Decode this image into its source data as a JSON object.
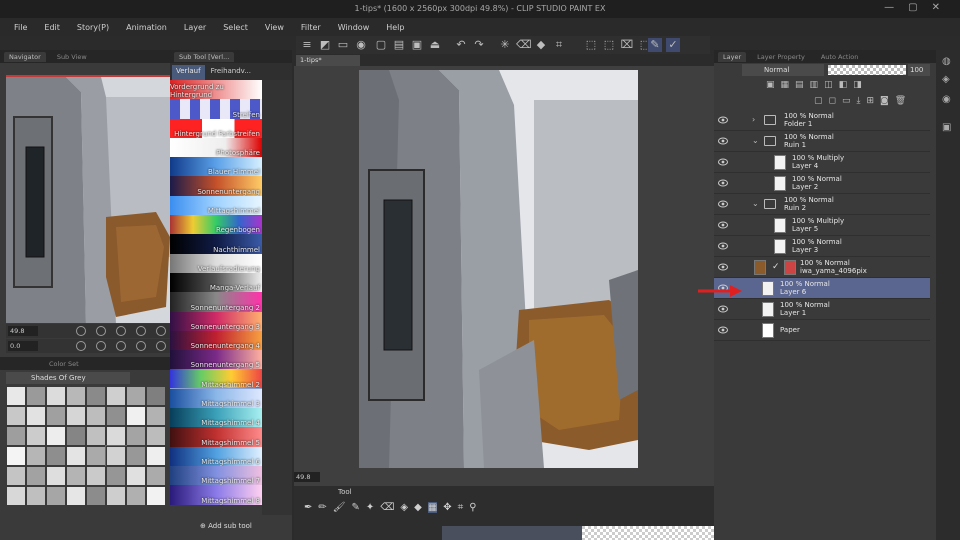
{
  "titlebar": {
    "title": "1-tips* (1600 x 2560px 300dpi 49.8%) - CLIP STUDIO PAINT EX"
  },
  "menu": [
    "File",
    "Edit",
    "Story(P)",
    "Animation",
    "Layer",
    "Select",
    "View",
    "Filter",
    "Window",
    "Help"
  ],
  "left_panel": {
    "tabs": [
      "Navigator",
      "Sub View"
    ],
    "zoom_value": "49.8",
    "angle_value": "0.0",
    "colorset_tab": "Color Set",
    "colorset_name": "Shades Of Grey",
    "swatches": [
      "#e8e8e8",
      "#9a9a9a",
      "#dcdcdc",
      "#b8b8b8",
      "#8a8a8a",
      "#cfcfcf",
      "#a8a8a8",
      "#7f7f7f",
      "#c8c8c8",
      "#e2e2e2",
      "#a0a0a0",
      "#d6d6d6",
      "#bdbdbd",
      "#909090",
      "#f0f0f0",
      "#b2b2b2",
      "#9e9e9e",
      "#cccccc",
      "#ededed",
      "#858585",
      "#c0c0c0",
      "#dadada",
      "#a4a4a4",
      "#bcbcbc",
      "#f4f4f4",
      "#b6b6b6",
      "#8e8e8e",
      "#e4e4e4",
      "#aaaaaa",
      "#d2d2d2",
      "#989898",
      "#eeeeee",
      "#c4c4c4",
      "#a2a2a2",
      "#dedede",
      "#b4b4b4",
      "#cacaca",
      "#969696",
      "#e0e0e0",
      "#ababab",
      "#d8d8d8",
      "#bfbfbf",
      "#a6a6a6",
      "#e6e6e6",
      "#8c8c8c",
      "#cecece",
      "#b0b0b0",
      "#f2f2f2"
    ]
  },
  "subtool_panel": {
    "header_tab": "Sub Tool [Verl...",
    "tabs": [
      "Verlauf",
      "Freihandv..."
    ],
    "add_label": "Add sub tool",
    "gradients": [
      {
        "label": "Vordergrund zu Hintergrund",
        "css": "linear-gradient(90deg,#d22,#fff)"
      },
      {
        "label": "Streifen",
        "css": "repeating-linear-gradient(90deg,#4d58c9 0 10px,#e8e8f8 10px 20px)"
      },
      {
        "label": "Hintergrund Farbstreifen",
        "css": "linear-gradient(90deg,#f22 0 35%,#fff 35% 70%,#f22 70%)"
      },
      {
        "label": "Photosphäre",
        "css": "linear-gradient(90deg,#fff,#eee 60%,#d00)"
      },
      {
        "label": "Blauer Himmel",
        "css": "linear-gradient(90deg,#103a8a,#5aa0e8,#d6f0ff)"
      },
      {
        "label": "Sonnenuntergang",
        "css": "linear-gradient(90deg,#1b1b4a,#c4502a,#ffcc66)"
      },
      {
        "label": "Mittagshimmel",
        "css": "linear-gradient(90deg,#3b8ef0,#9fd2ff,#e8f6ff)"
      },
      {
        "label": "Regenbogen",
        "css": "linear-gradient(90deg,#a33,#ec3,#3c6,#36c,#a3c)"
      },
      {
        "label": "Nachthimmel",
        "css": "linear-gradient(90deg,#000,#101b45,#3a5aa8)"
      },
      {
        "label": "Verlaufsradierung",
        "css": "linear-gradient(90deg,#777,#ddd,#fff)"
      },
      {
        "label": "Manga-Verlauf",
        "css": "linear-gradient(90deg,#000,#555,#eee)"
      },
      {
        "label": "Sonnenuntergang 2",
        "css": "linear-gradient(90deg,#222,#888,#f3a)"
      },
      {
        "label": "Sonnenuntergang 3",
        "css": "linear-gradient(90deg,#301045,#d02a66,#ffb070)"
      },
      {
        "label": "Sonnenuntergang 4",
        "css": "linear-gradient(90deg,#2a1140,#c02030,#f7a040)"
      },
      {
        "label": "Sonnenuntergang 5",
        "css": "linear-gradient(90deg,#20103a,#7a2a88,#ffb0a0)"
      },
      {
        "label": "Mittagshimmel 2",
        "css": "linear-gradient(90deg,#33d,#6c6,#fc3,#e44)"
      },
      {
        "label": "Mittagshimmel 3",
        "css": "linear-gradient(90deg,#1a4fa0,#8ab6e8,#dfe8ff)"
      },
      {
        "label": "Mittagshimmel 4",
        "css": "linear-gradient(90deg,#073e5a,#3aa0b8,#a8f0f0)"
      },
      {
        "label": "Mittagshimmel 5",
        "css": "linear-gradient(90deg,#401010,#c03030,#ff8a8a)"
      },
      {
        "label": "Mittagshimmel 6",
        "css": "linear-gradient(90deg,#103080,#50a0e0,#e0f0ff)"
      },
      {
        "label": "Mittagshimmel 7",
        "css": "linear-gradient(90deg,#204080,#8090e0,#f0c0e0)"
      },
      {
        "label": "Mittagshimmel 8",
        "css": "linear-gradient(90deg,#2a1a7a,#8a7ae8,#ffd0f0)"
      }
    ]
  },
  "canvas": {
    "doc_tab": "1-tips*",
    "zoom": "49.8"
  },
  "tool_panel": {
    "tab": "Tool"
  },
  "layer_panel": {
    "tabs": [
      "Layer",
      "Layer Property",
      "Auto Action"
    ],
    "blend_mode": "Normal",
    "opacity": "100",
    "layers": [
      {
        "line1": "100 % Normal",
        "line2": "Folder 1",
        "kind": "folder",
        "indent": 0,
        "chev": "›",
        "sel": false
      },
      {
        "line1": "100 % Normal",
        "line2": "Ruin 1",
        "kind": "folder",
        "indent": 0,
        "chev": "⌄",
        "sel": false
      },
      {
        "line1": "100 % Multiply",
        "line2": "Layer 4",
        "kind": "layer",
        "indent": 1,
        "chev": "",
        "sel": false
      },
      {
        "line1": "100 % Normal",
        "line2": "Layer 2",
        "kind": "layer",
        "indent": 1,
        "chev": "",
        "sel": false
      },
      {
        "line1": "100 % Normal",
        "line2": "Ruin 2",
        "kind": "folder",
        "indent": 0,
        "chev": "⌄",
        "sel": false
      },
      {
        "line1": "100 % Multiply",
        "line2": "Layer 5",
        "kind": "layer",
        "indent": 1,
        "chev": "",
        "sel": false
      },
      {
        "line1": "100 % Normal",
        "line2": "Layer 3",
        "kind": "layer",
        "indent": 1,
        "chev": "",
        "sel": false
      },
      {
        "line1": "100 % Normal",
        "line2": "iwa_yama_4096pix",
        "kind": "image",
        "indent": 2,
        "chev": "",
        "sel": false
      },
      {
        "line1": "100 % Normal",
        "line2": "Layer 6",
        "kind": "layer",
        "indent": 0,
        "chev": "",
        "sel": true
      },
      {
        "line1": "100 % Normal",
        "line2": "Layer 1",
        "kind": "layer",
        "indent": 0,
        "chev": "",
        "sel": false
      },
      {
        "line1": "",
        "line2": "Paper",
        "kind": "paper",
        "indent": 0,
        "chev": "",
        "sel": false
      }
    ]
  },
  "colors": {
    "selected_layer": "#5b6690",
    "highlight_arrow": "#e02020",
    "nav_border": "#c23b3b"
  }
}
